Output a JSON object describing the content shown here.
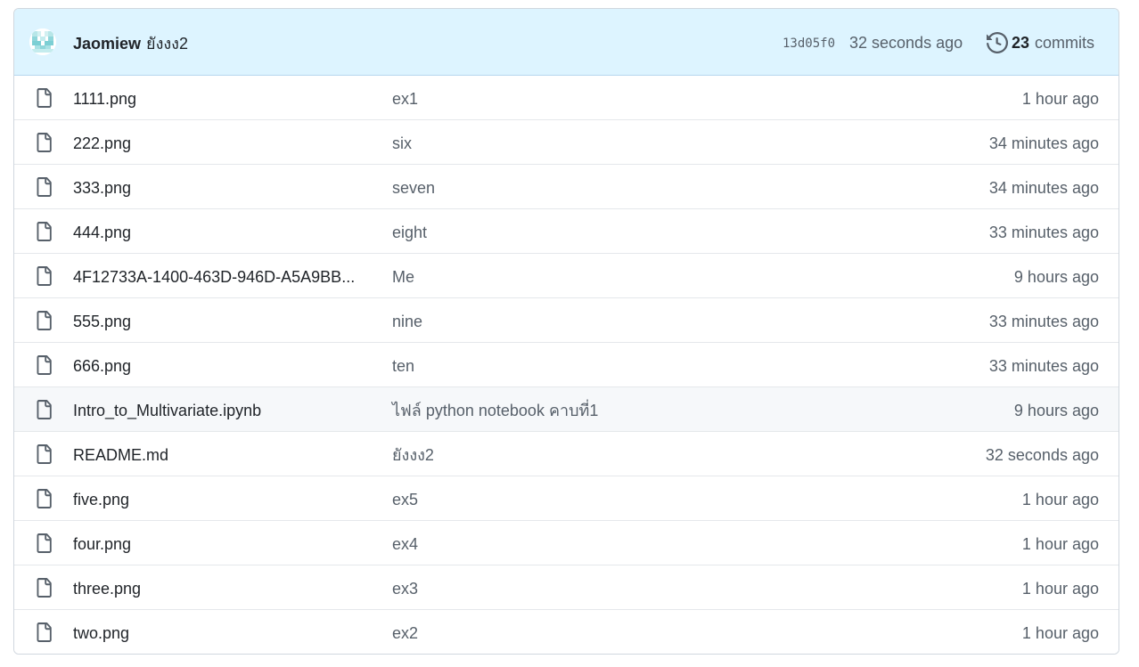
{
  "latest_commit": {
    "author": "Jaomiew",
    "message": "ยังงง2",
    "sha": "13d05f0",
    "time": "32 seconds ago",
    "commit_count": "23",
    "commits_label": "commits"
  },
  "files": [
    {
      "name": "1111.png",
      "message": "ex1",
      "time": "1 hour ago"
    },
    {
      "name": "222.png",
      "message": "six",
      "time": "34 minutes ago"
    },
    {
      "name": "333.png",
      "message": "seven",
      "time": "34 minutes ago"
    },
    {
      "name": "444.png",
      "message": "eight",
      "time": "33 minutes ago"
    },
    {
      "name": "4F12733A-1400-463D-946D-A5A9BB...",
      "message": "Me",
      "time": "9 hours ago"
    },
    {
      "name": "555.png",
      "message": "nine",
      "time": "33 minutes ago"
    },
    {
      "name": "666.png",
      "message": "ten",
      "time": "33 minutes ago"
    },
    {
      "name": "Intro_to_Multivariate.ipynb",
      "message": "ไฟล์ python notebook คาบที่1",
      "time": "9 hours ago"
    },
    {
      "name": "README.md",
      "message": "ยังงง2",
      "time": "32 seconds ago"
    },
    {
      "name": "five.png",
      "message": "ex5",
      "time": "1 hour ago"
    },
    {
      "name": "four.png",
      "message": "ex4",
      "time": "1 hour ago"
    },
    {
      "name": "three.png",
      "message": "ex3",
      "time": "1 hour ago"
    },
    {
      "name": "two.png",
      "message": "ex2",
      "time": "1 hour ago"
    }
  ],
  "icons": {
    "avatar": "identicon-avatar",
    "history": "history-icon",
    "file": "file-icon"
  },
  "colors": {
    "header_bg": "#ddf4ff",
    "muted_text": "#57606a",
    "primary_text": "#1f2328",
    "hover_row": "#f6f8fa"
  }
}
